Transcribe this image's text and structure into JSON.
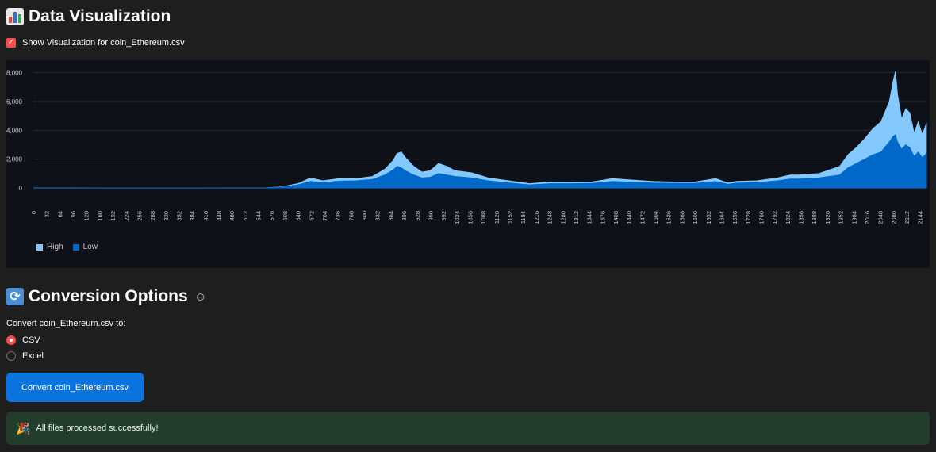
{
  "viz_section": {
    "title": "Data Visualization",
    "icon": "bar-chart-icon",
    "checkbox_label": "Show Visualization for coin_Ethereum.csv",
    "checkbox_checked": true
  },
  "chart_data": {
    "type": "area",
    "x_range": [
      0,
      2160
    ],
    "ylim": [
      0,
      8200
    ],
    "y_ticks": [
      "0",
      "2,000",
      "4,000",
      "6,000",
      "8,000"
    ],
    "x_ticks": [
      "0",
      "32",
      "64",
      "96",
      "128",
      "160",
      "192",
      "224",
      "256",
      "288",
      "320",
      "352",
      "384",
      "416",
      "448",
      "480",
      "512",
      "544",
      "576",
      "608",
      "640",
      "672",
      "704",
      "736",
      "768",
      "800",
      "832",
      "864",
      "896",
      "928",
      "960",
      "992",
      "1024",
      "1056",
      "1088",
      "1120",
      "1152",
      "1184",
      "1216",
      "1248",
      "1280",
      "1312",
      "1344",
      "1376",
      "1408",
      "1440",
      "1472",
      "1504",
      "1536",
      "1568",
      "1600",
      "1632",
      "1664",
      "1696",
      "1728",
      "1760",
      "1792",
      "1824",
      "1856",
      "1888",
      "1920",
      "1952",
      "1984",
      "2016",
      "2048",
      "2080",
      "2112",
      "2144"
    ],
    "legend_placement": "bottom-left",
    "grid": true,
    "series": [
      {
        "name": "High",
        "color": "#83c9ff",
        "x": [
          0,
          100,
          200,
          300,
          400,
          500,
          560,
          600,
          640,
          670,
          700,
          740,
          780,
          820,
          850,
          870,
          880,
          890,
          900,
          920,
          940,
          960,
          980,
          1000,
          1020,
          1060,
          1100,
          1150,
          1200,
          1250,
          1300,
          1350,
          1400,
          1450,
          1500,
          1550,
          1600,
          1650,
          1680,
          1700,
          1750,
          1800,
          1830,
          1850,
          1900,
          1950,
          1970,
          1990,
          2010,
          2030,
          2050,
          2070,
          2080,
          2085,
          2090,
          2100,
          2110,
          2120,
          2130,
          2140,
          2150,
          2160
        ],
        "values": [
          2,
          3,
          5,
          5,
          4,
          3,
          5,
          80,
          300,
          700,
          500,
          650,
          650,
          800,
          1300,
          1900,
          2400,
          2500,
          2100,
          1500,
          1100,
          1200,
          1700,
          1500,
          1200,
          1050,
          700,
          500,
          300,
          420,
          400,
          420,
          650,
          550,
          450,
          420,
          420,
          650,
          350,
          460,
          500,
          700,
          900,
          900,
          1000,
          1500,
          2300,
          2800,
          3400,
          4100,
          4600,
          6000,
          7500,
          8100,
          6500,
          4800,
          5500,
          5200,
          3800,
          4600,
          3700,
          4500
        ]
      },
      {
        "name": "Low",
        "color": "#0068c9",
        "x": [
          0,
          100,
          200,
          300,
          400,
          500,
          560,
          600,
          640,
          670,
          700,
          740,
          780,
          820,
          850,
          870,
          880,
          890,
          900,
          920,
          940,
          960,
          980,
          1000,
          1020,
          1060,
          1100,
          1150,
          1200,
          1250,
          1300,
          1350,
          1400,
          1450,
          1500,
          1550,
          1600,
          1650,
          1680,
          1700,
          1750,
          1800,
          1830,
          1850,
          1900,
          1950,
          1970,
          1990,
          2010,
          2030,
          2050,
          2070,
          2080,
          2085,
          2090,
          2100,
          2110,
          2120,
          2130,
          2140,
          2150,
          2160
        ],
        "values": [
          1,
          2,
          4,
          4,
          3,
          2,
          4,
          60,
          220,
          450,
          380,
          480,
          500,
          600,
          900,
          1250,
          1500,
          1400,
          1200,
          900,
          700,
          750,
          1000,
          900,
          800,
          700,
          500,
          350,
          220,
          300,
          300,
          320,
          450,
          400,
          340,
          320,
          320,
          450,
          260,
          340,
          380,
          500,
          620,
          620,
          700,
          900,
          1400,
          1700,
          2000,
          2300,
          2500,
          3200,
          3600,
          3700,
          3200,
          2700,
          3000,
          2800,
          2200,
          2500,
          2100,
          2400
        ]
      }
    ]
  },
  "conversion_section": {
    "title": "Conversion Options",
    "icon": "refresh-icon",
    "link_icon": "link-icon",
    "prompt": "Convert coin_Ethereum.csv to:",
    "options": [
      "CSV",
      "Excel"
    ],
    "selected": "CSV",
    "button_label": "Convert coin_Ethereum.csv",
    "accent_color": "#ff4b4b",
    "button_color": "#0b74de"
  },
  "status": {
    "message": "All files processed successfully!",
    "icon": "party-popper-icon",
    "color": "#233d2c"
  }
}
